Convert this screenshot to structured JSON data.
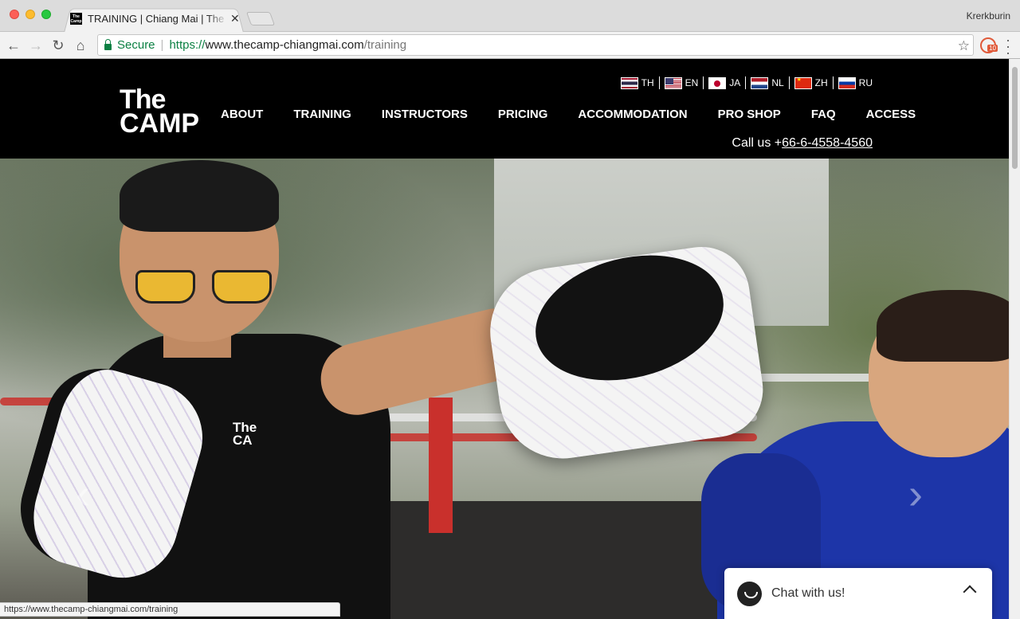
{
  "browser": {
    "tab_title": "TRAINING | Chiang Mai | The Camp",
    "favicon_text": "The Camp",
    "profile_name": "Krerkburin",
    "secure_label": "Secure",
    "url_scheme": "https://",
    "url_host": "www.thecamp-chiangmai.com",
    "url_path": "/training",
    "extension_badge": "10",
    "status_url": "https://www.thecamp-chiangmai.com/training"
  },
  "site": {
    "logo_line1": "The",
    "logo_line2": "CAMP",
    "languages": [
      {
        "code": "TH",
        "flag": "thailand-flag"
      },
      {
        "code": "EN",
        "flag": "usa-flag"
      },
      {
        "code": "JA",
        "flag": "japan-flag"
      },
      {
        "code": "NL",
        "flag": "netherlands-flag"
      },
      {
        "code": "ZH",
        "flag": "china-flag"
      },
      {
        "code": "RU",
        "flag": "russia-flag"
      }
    ],
    "nav": [
      "ABOUT",
      "TRAINING",
      "INSTRUCTORS",
      "PRICING",
      "ACCOMMODATION",
      "PRO SHOP",
      "FAQ",
      "ACCESS"
    ],
    "call_prefix": "Call us +",
    "phone": "66-6-4558-4560",
    "shirt_logo_1": "The",
    "shirt_logo_2": "CA"
  },
  "hero": {
    "prev_arrow": "‹",
    "next_arrow": "›"
  },
  "chat": {
    "label": "Chat with us!"
  },
  "colors": {
    "header_bg": "#000000",
    "secure_green": "#0b8043",
    "chat_bg": "#ffffff"
  }
}
